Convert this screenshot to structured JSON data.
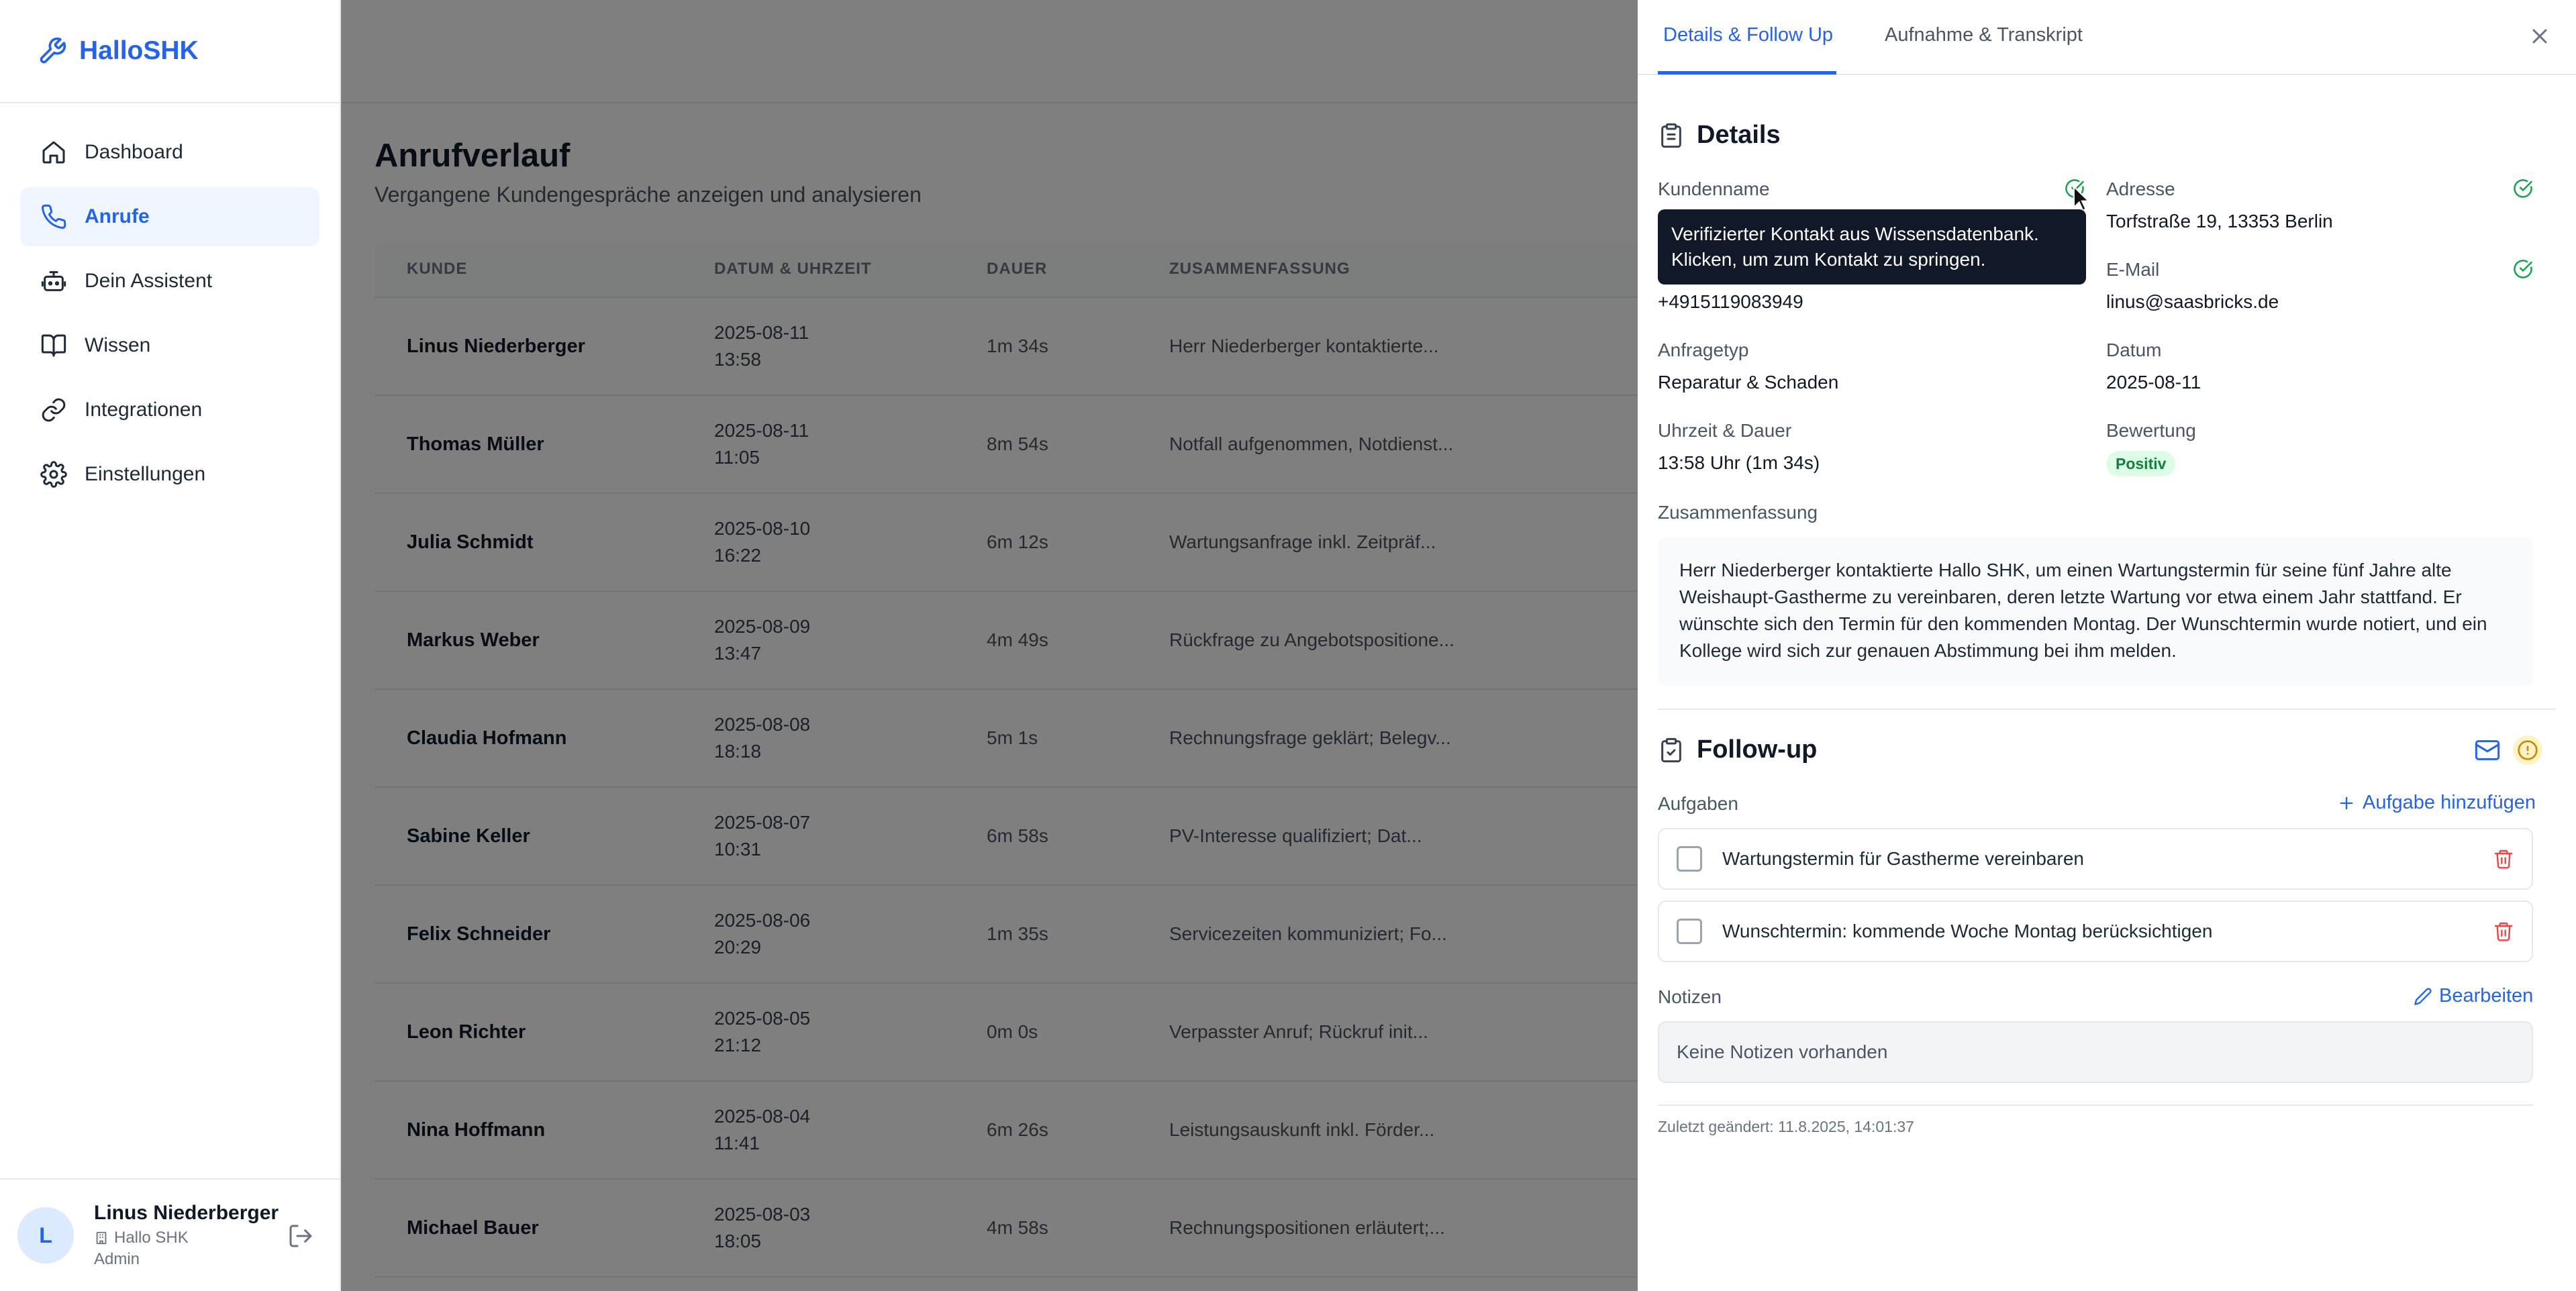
{
  "brand": {
    "name": "HalloSHK"
  },
  "sidebar": {
    "items": [
      {
        "label": "Dashboard",
        "icon": "home-icon"
      },
      {
        "label": "Anrufe",
        "icon": "phone-icon",
        "active": true
      },
      {
        "label": "Dein Assistent",
        "icon": "robot-icon"
      },
      {
        "label": "Wissen",
        "icon": "book-icon"
      },
      {
        "label": "Integrationen",
        "icon": "link-icon"
      },
      {
        "label": "Einstellungen",
        "icon": "gear-icon"
      }
    ],
    "user": {
      "initial": "L",
      "name": "Linus Niederberger",
      "company": "Hallo SHK",
      "role": "Admin"
    }
  },
  "main": {
    "title": "Anrufverlauf",
    "subtitle": "Vergangene Kundengespräche anzeigen und analysieren",
    "columns": [
      "KUNDE",
      "DATUM & UHRZEIT",
      "DAUER",
      "ZUSAMMENFASSUNG"
    ],
    "rows": [
      {
        "kunde": "Linus Niederberger",
        "datum": "2025-08-11",
        "zeit": "13:58",
        "dauer": "1m 34s",
        "summary": "Herr Niederberger kontaktierte..."
      },
      {
        "kunde": "Thomas Müller",
        "datum": "2025-08-11",
        "zeit": "11:05",
        "dauer": "8m 54s",
        "summary": "Notfall aufgenommen, Notdienst..."
      },
      {
        "kunde": "Julia Schmidt",
        "datum": "2025-08-10",
        "zeit": "16:22",
        "dauer": "6m 12s",
        "summary": "Wartungsanfrage inkl. Zeitpräf..."
      },
      {
        "kunde": "Markus Weber",
        "datum": "2025-08-09",
        "zeit": "13:47",
        "dauer": "4m 49s",
        "summary": "Rückfrage zu Angebotspositione..."
      },
      {
        "kunde": "Claudia Hofmann",
        "datum": "2025-08-08",
        "zeit": "18:18",
        "dauer": "5m 1s",
        "summary": "Rechnungsfrage geklärt; Belegv..."
      },
      {
        "kunde": "Sabine Keller",
        "datum": "2025-08-07",
        "zeit": "10:31",
        "dauer": "6m 58s",
        "summary": "PV-Interesse qualifiziert; Dat..."
      },
      {
        "kunde": "Felix Schneider",
        "datum": "2025-08-06",
        "zeit": "20:29",
        "dauer": "1m 35s",
        "summary": "Servicezeiten kommuniziert; Fo..."
      },
      {
        "kunde": "Leon Richter",
        "datum": "2025-08-05",
        "zeit": "21:12",
        "dauer": "0m 0s",
        "summary": "Verpasster Anruf; Rückruf init..."
      },
      {
        "kunde": "Nina Hoffmann",
        "datum": "2025-08-04",
        "zeit": "11:41",
        "dauer": "6m 26s",
        "summary": "Leistungsauskunft inkl. Förder..."
      },
      {
        "kunde": "Michael Bauer",
        "datum": "2025-08-03",
        "zeit": "18:05",
        "dauer": "4m 58s",
        "summary": "Rechnungspositionen erläutert;..."
      }
    ]
  },
  "panel": {
    "tabs": [
      "Details & Follow Up",
      "Aufnahme & Transkript"
    ],
    "details": {
      "title": "Details",
      "kundenname_label": "Kundenname",
      "tooltip_line1": "Verifizierter Kontakt aus Wissensdatenbank.",
      "tooltip_line2": "Klicken, um zum Kontakt zu springen.",
      "phone": "+4915119083949",
      "adresse_label": "Adresse",
      "adresse": "Torfstraße 19, 13353 Berlin",
      "email_label": "E-Mail",
      "email": "linus@saasbricks.de",
      "anfragetyp_label": "Anfragetyp",
      "anfragetyp": "Reparatur & Schaden",
      "datum_label": "Datum",
      "datum": "2025-08-11",
      "uhrzeit_label": "Uhrzeit & Dauer",
      "uhrzeit": "13:58 Uhr (1m 34s)",
      "bewertung_label": "Bewertung",
      "bewertung": "Positiv",
      "zusammenfassung_label": "Zusammenfassung",
      "zusammenfassung": "Herr Niederberger kontaktierte Hallo SHK, um einen Wartungstermin für seine fünf Jahre alte Weishaupt-Gastherme zu vereinbaren, deren letzte Wartung vor etwa einem Jahr stattfand. Er wünschte sich den Termin für den kommenden Montag. Der Wunschtermin wurde notiert, und ein Kollege wird sich zur genauen Abstimmung bei ihm melden."
    },
    "followup": {
      "title": "Follow-up",
      "aufgaben_label": "Aufgaben",
      "add_task": "Aufgabe hinzufügen",
      "tasks": [
        "Wartungstermin für Gastherme vereinbaren",
        "Wunschtermin: kommende Woche Montag berücksichtigen"
      ],
      "notizen_label": "Notizen",
      "edit": "Bearbeiten",
      "notes_empty": "Keine Notizen vorhanden",
      "last_changed": "Zuletzt geändert: 11.8.2025, 14:01:37"
    }
  }
}
